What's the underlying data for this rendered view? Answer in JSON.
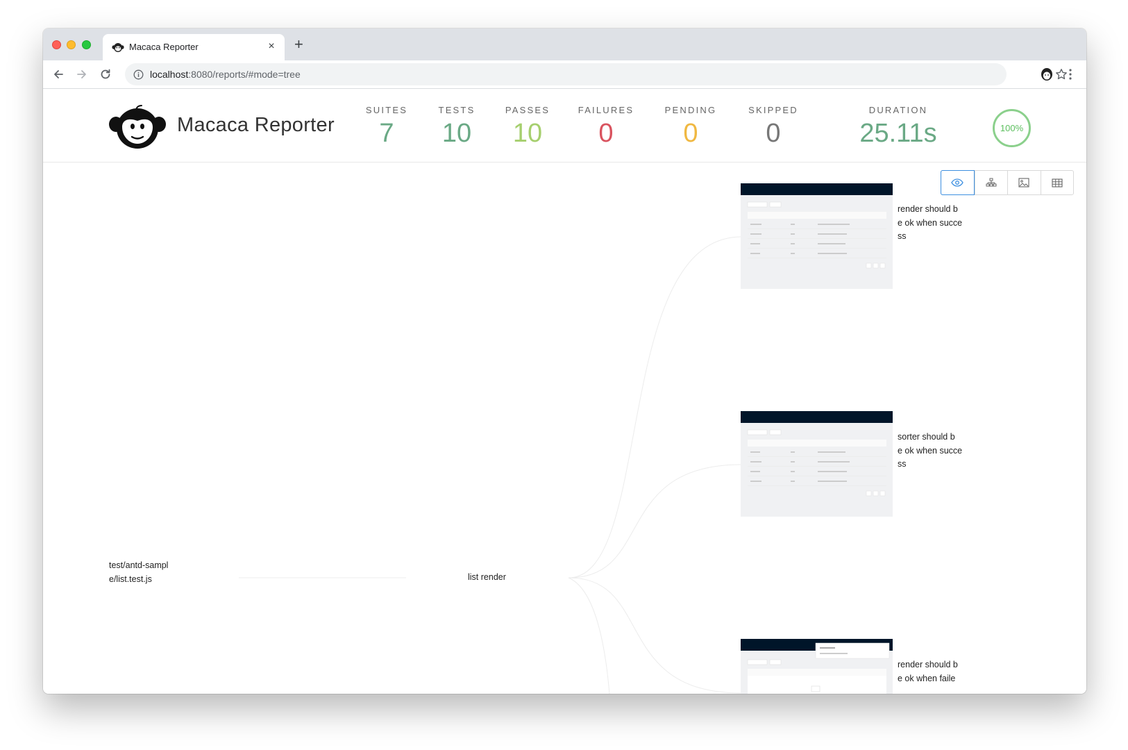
{
  "browser": {
    "tab_title": "Macaca Reporter",
    "new_tab_symbol": "+",
    "close_symbol": "×",
    "url_host": "localhost",
    "url_rest": ":8080/reports/#mode=tree"
  },
  "header": {
    "brand": "Macaca Reporter",
    "stats": [
      {
        "label": "SUITES",
        "value": "7",
        "color": "#6aa985"
      },
      {
        "label": "TESTS",
        "value": "10",
        "color": "#6aa985"
      },
      {
        "label": "PASSES",
        "value": "10",
        "color": "#a6cf6e"
      },
      {
        "label": "FAILURES",
        "value": "0",
        "color": "#d9535f"
      },
      {
        "label": "PENDING",
        "value": "0",
        "color": "#f0b842"
      },
      {
        "label": "SKIPPED",
        "value": "0",
        "color": "#777777"
      },
      {
        "label": "DURATION",
        "value": "25.11s",
        "color": "#6aa985"
      }
    ],
    "pass_rate": "100%"
  },
  "view_modes": [
    {
      "icon": "eye-icon",
      "active": true
    },
    {
      "icon": "tree-icon",
      "active": false
    },
    {
      "icon": "image-icon",
      "active": false
    },
    {
      "icon": "table-icon",
      "active": false
    }
  ],
  "tree": {
    "root": [
      "test/antd-sampl",
      "e/list.test.js"
    ],
    "suite": "list render",
    "cases": [
      {
        "lines": [
          "render should b",
          "e ok when succe",
          "ss"
        ]
      },
      {
        "lines": [
          "sorter should b",
          "e ok when succe",
          "ss"
        ]
      },
      {
        "lines": [
          "render should b",
          "e ok when faile"
        ]
      }
    ]
  }
}
